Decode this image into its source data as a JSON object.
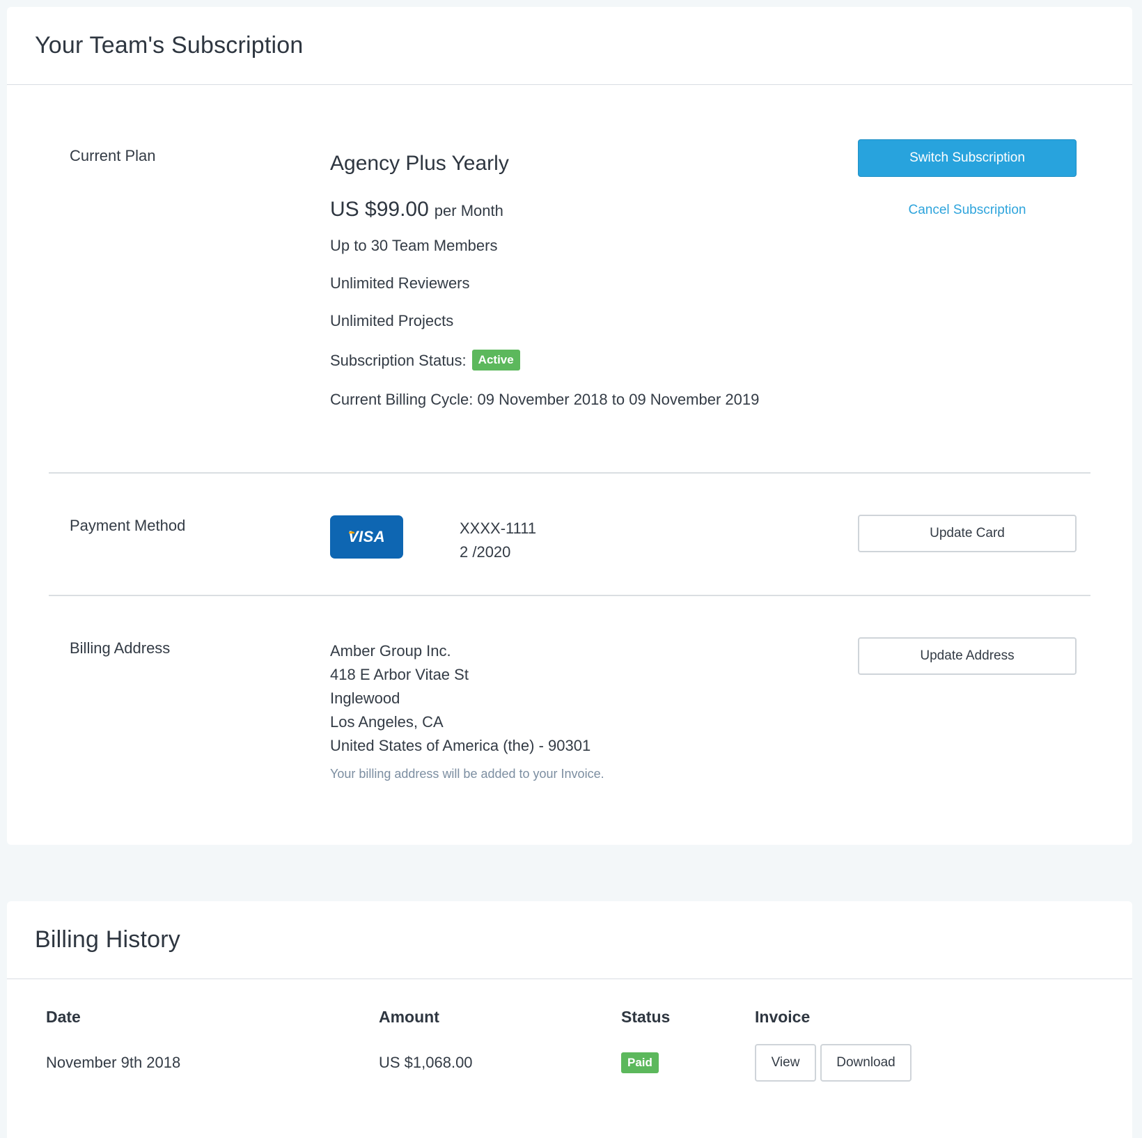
{
  "subscription": {
    "title": "Your Team's Subscription",
    "plan": {
      "label": "Current Plan",
      "name": "Agency Plus Yearly",
      "price": "US $99.00",
      "period": "per Month",
      "features": [
        "Up to 30 Team Members",
        "Unlimited Reviewers",
        "Unlimited Projects"
      ],
      "status_label": "Subscription Status:",
      "status_value": "Active",
      "billing_cycle": "Current Billing Cycle: 09 November 2018 to 09 November 2019",
      "switch_label": "Switch Subscription",
      "cancel_label": "Cancel Subscription"
    },
    "payment": {
      "label": "Payment Method",
      "card_brand": "VISA",
      "card_number": "XXXX-1111",
      "card_expiry": "2 /2020",
      "update_label": "Update Card"
    },
    "address": {
      "label": "Billing Address",
      "lines": [
        "Amber Group Inc.",
        "418 E Arbor Vitae St",
        "Inglewood",
        "Los Angeles, CA",
        "United States of America (the) - 90301"
      ],
      "note": "Your billing address will be added to your Invoice.",
      "update_label": "Update Address"
    }
  },
  "history": {
    "title": "Billing History",
    "columns": [
      "Date",
      "Amount",
      "Status",
      "Invoice"
    ],
    "rows": [
      {
        "date": "November 9th 2018",
        "amount": "US $1,068.00",
        "status": "Paid",
        "view_label": "View",
        "download_label": "Download"
      }
    ]
  },
  "colors": {
    "primary": "#28a3dd",
    "success": "#5cb85c",
    "visa": "#0e66b2",
    "note": "#7c8ea1"
  }
}
